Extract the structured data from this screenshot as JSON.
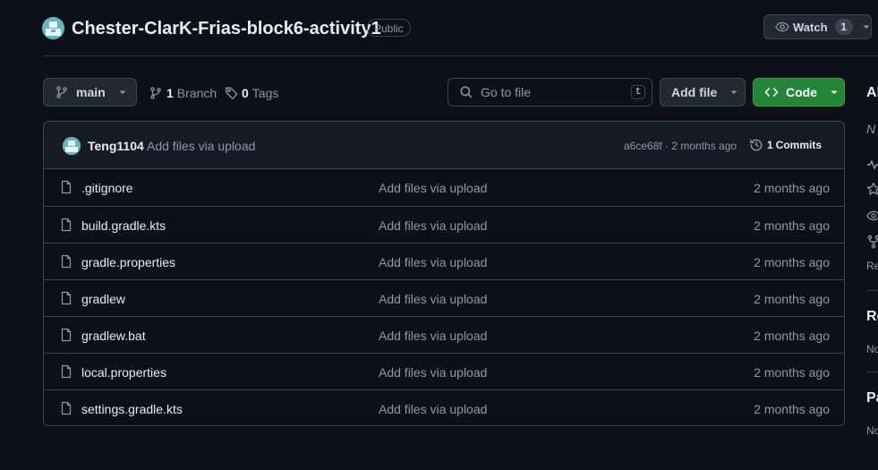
{
  "repo": {
    "name": "Chester-ClarK-Frias-block6-activity1",
    "visibility": "Public",
    "watch_label": "Watch",
    "watch_count": "1"
  },
  "toolbar": {
    "branch": "main",
    "branch_count": "1",
    "branch_label": "Branch",
    "tag_count": "0",
    "tag_label": "Tags",
    "search_placeholder": "Go to file",
    "search_shortcut": "t",
    "add_file_label": "Add file",
    "code_label": "Code"
  },
  "latest_commit": {
    "author": "Teng1104",
    "message": "Add files via upload",
    "meta": "a6ce68f · 2 months ago",
    "commits_count": "1",
    "commits_label": "Commits"
  },
  "files": [
    {
      "name": ".gitignore",
      "commit": "Add files via upload",
      "age": "2 months ago"
    },
    {
      "name": "build.gradle.kts",
      "commit": "Add files via upload",
      "age": "2 months ago"
    },
    {
      "name": "gradle.properties",
      "commit": "Add files via upload",
      "age": "2 months ago"
    },
    {
      "name": "gradlew",
      "commit": "Add files via upload",
      "age": "2 months ago"
    },
    {
      "name": "gradlew.bat",
      "commit": "Add files via upload",
      "age": "2 months ago"
    },
    {
      "name": "local.properties",
      "commit": "Add files via upload",
      "age": "2 months ago"
    },
    {
      "name": "settings.gradle.kts",
      "commit": "Add files via upload",
      "age": "2 months ago"
    }
  ],
  "sidebar": {
    "about_fragment": "Ab",
    "desc_fragment": "N",
    "readme_fragment": "Re",
    "releases_fragment": "Re",
    "releases_sub_fragment": "No",
    "packages_fragment": "Pa",
    "packages_sub_fragment": "No"
  },
  "colors": {
    "background": "#0d1117",
    "code_button": "#238636",
    "border": "#3d444d",
    "muted_text": "#9198a1"
  }
}
